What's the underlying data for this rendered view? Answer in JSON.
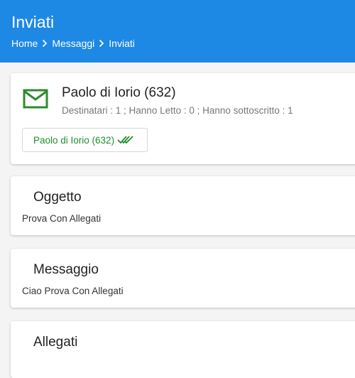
{
  "header": {
    "title": "Inviati",
    "breadcrumb": [
      "Home",
      "Messaggi",
      "Inviati"
    ]
  },
  "sender_card": {
    "icon": "mail-icon",
    "name": "Paolo di Iorio (632)",
    "stats": "Destinatari :  1 ;  Hanno Letto :  0 ;  Hanno sottoscritto :  1",
    "recipient_chip": {
      "label": "Paolo di Iorio (632)",
      "status_icon": "double-check-icon"
    }
  },
  "subject_card": {
    "title": "Oggetto",
    "value": "Prova Con Allegati"
  },
  "message_card": {
    "title": "Messaggio",
    "value": "Ciao Prova Con Allegati"
  },
  "attachments_card": {
    "title": "Allegati"
  },
  "colors": {
    "header_bg": "#1e88e5",
    "accent_green": "#1f8f2a",
    "page_bg": "#f4f4f4"
  }
}
